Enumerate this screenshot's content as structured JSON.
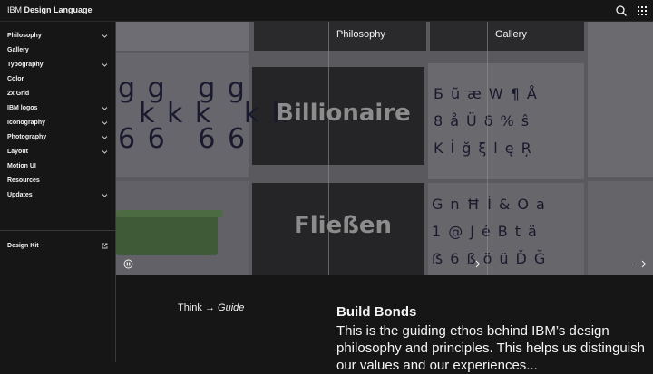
{
  "header": {
    "brand_prefix": "IBM",
    "brand_name": "Design Language",
    "search_icon": "search-icon",
    "apps_icon": "app-switcher-icon"
  },
  "sidebar": {
    "items": [
      {
        "label": "Philosophy",
        "expandable": true
      },
      {
        "label": "Gallery",
        "expandable": false
      },
      {
        "label": "Typography",
        "expandable": true
      },
      {
        "label": "Color",
        "expandable": false
      },
      {
        "label": "2x Grid",
        "expandable": false
      },
      {
        "label": "IBM logos",
        "expandable": true
      },
      {
        "label": "Iconography",
        "expandable": true
      },
      {
        "label": "Photography",
        "expandable": true
      },
      {
        "label": "Layout",
        "expandable": true
      },
      {
        "label": "Motion UI",
        "expandable": false
      },
      {
        "label": "Resources",
        "expandable": false
      },
      {
        "label": "Updates",
        "expandable": true
      }
    ],
    "design_kit": {
      "label": "Design Kit",
      "icon": "launch-icon"
    }
  },
  "hero": {
    "labels": [
      "Philosophy",
      "Gallery"
    ],
    "words": [
      "Billionaire",
      "Fließen"
    ],
    "glyph_rows": [
      "g g   g g",
      "  k k k   k k",
      "6 6   6 6"
    ],
    "glyph_grid_top": [
      "Б",
      "ũ",
      "æ",
      "W",
      "¶",
      "Å"
    ],
    "glyph_grid_mid": [
      "8",
      "å",
      "Ü",
      "δ",
      "%",
      "ŝ"
    ],
    "glyph_grid_low": [
      "K",
      "İ",
      "ğ",
      "ξ",
      "l",
      "ę",
      "Ŗ"
    ],
    "glyph_grid_b1": [
      "G",
      "n",
      "Ħ",
      "İ",
      "&",
      "O",
      "a"
    ],
    "glyph_grid_b2": [
      "1",
      "@",
      "J",
      "é",
      "B",
      "t",
      "ä"
    ],
    "glyph_grid_b3": [
      "ẞ",
      "6",
      "ß",
      "ö",
      "ü",
      "Ď",
      "Ğ"
    ],
    "play_icon": "pause-icon",
    "arrow_icon": "arrow-right-icon"
  },
  "content": {
    "think_prefix": "Think → ",
    "think_italic": "Guide",
    "title": "Build Bonds",
    "body": "This is the guiding ethos behind IBM’s design philosophy and principles. This helps us distinguish our values and our experiences..."
  }
}
